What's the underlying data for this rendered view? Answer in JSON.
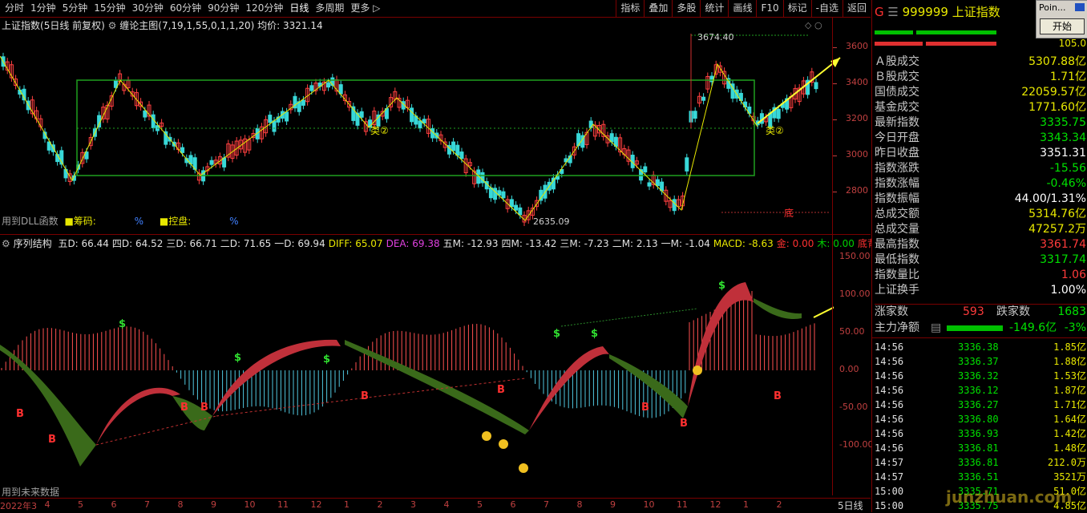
{
  "toolbar": {
    "timeframes": [
      "分时",
      "1分钟",
      "5分钟",
      "15分钟",
      "30分钟",
      "60分钟",
      "90分钟",
      "120分钟",
      "日线",
      "多周期",
      "更多 ▷"
    ],
    "active_index": 8,
    "tools": [
      "指标",
      "叠加",
      "多股",
      "统计",
      "画线",
      "F10",
      "标记",
      "-自选",
      "返回"
    ]
  },
  "main_chart": {
    "name": "上证指数",
    "subtitle": "(5日线 前复权)",
    "indicator": "缠论主图(7,19,1,55,0,1,1,20)",
    "avg_label": "均价: 3321.14",
    "high_label": "3674.40",
    "low_label": "2635.09",
    "dll_label": "用到DLL函数",
    "chips_label": "筹码:",
    "chips_pct": "%",
    "control_label": "控盘:",
    "control_pct": "%",
    "bottom_tag": "底",
    "lei_labels": [
      "类②",
      "类②"
    ],
    "y_ticks": [
      3600,
      3400,
      3200,
      3000,
      2800
    ]
  },
  "sub_chart": {
    "title": "序列结构",
    "values": [
      {
        "label": "五D: 66.44",
        "color": "#e0e0e0"
      },
      {
        "label": "四D: 64.52",
        "color": "#e0e0e0"
      },
      {
        "label": "三D: 66.71",
        "color": "#e0e0e0"
      },
      {
        "label": "二D: 71.65",
        "color": "#e0e0e0"
      },
      {
        "label": "一D: 69.94",
        "color": "#e0e0e0"
      },
      {
        "label": "DIFF: 65.07",
        "color": "#e8e800"
      },
      {
        "label": "DEA: 69.38",
        "color": "#e040e0"
      },
      {
        "label": "五M: -12.93",
        "color": "#e0e0e0"
      },
      {
        "label": "四M: -13.42",
        "color": "#e0e0e0"
      },
      {
        "label": "三M: -7.23",
        "color": "#e0e0e0"
      },
      {
        "label": "二M: 2.13",
        "color": "#e0e0e0"
      },
      {
        "label": "一M: -1.04",
        "color": "#e0e0e0"
      },
      {
        "label": "MACD: -8.63",
        "color": "#e8e800"
      },
      {
        "label": "金: 0.00",
        "color": "#ff3030"
      },
      {
        "label": "木: 0.00",
        "color": "#00d000"
      },
      {
        "label": "底背: -",
        "color": "#ff3030"
      }
    ],
    "future_label": "用到未来数据",
    "y_ticks": [
      "150.00",
      "100.00",
      "50.00",
      "0.00",
      "-50.00",
      "-100.00"
    ]
  },
  "x_axis": {
    "labels": [
      "2022年3",
      "4",
      "5",
      "6",
      "7",
      "8",
      "9",
      "10",
      "11",
      "12",
      "1",
      "2",
      "3",
      "4",
      "5",
      "6",
      "7",
      "8",
      "9",
      "10",
      "11",
      "12",
      "1",
      "2"
    ],
    "period": "5日线"
  },
  "panel": {
    "code": "999999",
    "name": "上证指数",
    "flag": "G",
    "ratio": "105.0",
    "rows": [
      {
        "label": "Ａ股成交",
        "value": "5307.88亿",
        "cls": "yel"
      },
      {
        "label": "Ｂ股成交",
        "value": "1.71亿",
        "cls": "yel"
      },
      {
        "label": "国债成交",
        "value": "22059.57亿",
        "cls": "yel"
      },
      {
        "label": "基金成交",
        "value": "1771.60亿",
        "cls": "yel"
      },
      {
        "label": "最新指数",
        "value": "3335.75",
        "cls": "grn"
      },
      {
        "label": "今日开盘",
        "value": "3343.34",
        "cls": "grn"
      },
      {
        "label": "昨日收盘",
        "value": "3351.31",
        "cls": "wht"
      },
      {
        "label": "指数涨跌",
        "value": "-15.56",
        "cls": "grn"
      },
      {
        "label": "指数涨幅",
        "value": "-0.46%",
        "cls": "grn"
      },
      {
        "label": "指数振幅",
        "value": "44.00/1.31%",
        "cls": "wht"
      },
      {
        "label": "总成交额",
        "value": "5314.76亿",
        "cls": "yel"
      },
      {
        "label": "总成交量",
        "value": "47257.2万",
        "cls": "yel"
      },
      {
        "label": "最高指数",
        "value": "3361.74",
        "cls": "red"
      },
      {
        "label": "最低指数",
        "value": "3317.74",
        "cls": "grn"
      },
      {
        "label": "指数量比",
        "value": "1.06",
        "cls": "red"
      },
      {
        "label": "上证换手",
        "value": "1.00%",
        "cls": "wht"
      }
    ],
    "up_label": "涨家数",
    "up_value": "593",
    "down_label": "跌家数",
    "down_value": "1683",
    "net_label": "主力净额",
    "net_value": "-149.6亿",
    "net_pct": "-3%",
    "ticks": [
      {
        "t": "14:56",
        "p": "3336.38",
        "v": "1.85亿"
      },
      {
        "t": "14:56",
        "p": "3336.37",
        "v": "1.88亿"
      },
      {
        "t": "14:56",
        "p": "3336.32",
        "v": "1.53亿"
      },
      {
        "t": "14:56",
        "p": "3336.12",
        "v": "1.87亿"
      },
      {
        "t": "14:56",
        "p": "3336.27",
        "v": "1.71亿"
      },
      {
        "t": "14:56",
        "p": "3336.80",
        "v": "1.64亿"
      },
      {
        "t": "14:56",
        "p": "3336.93",
        "v": "1.42亿"
      },
      {
        "t": "14:56",
        "p": "3336.81",
        "v": "1.48亿"
      },
      {
        "t": "14:57",
        "p": "3336.81",
        "v": "212.0万"
      },
      {
        "t": "14:57",
        "p": "3336.51",
        "v": "3521万"
      },
      {
        "t": "15:00",
        "p": "3335.71",
        "v": "51.0亿"
      },
      {
        "t": "15:00",
        "p": "3335.75",
        "v": "4.85亿"
      }
    ]
  },
  "popup": {
    "title": "Poin...",
    "button": "开始"
  },
  "watermark": "junzhuan.com"
}
